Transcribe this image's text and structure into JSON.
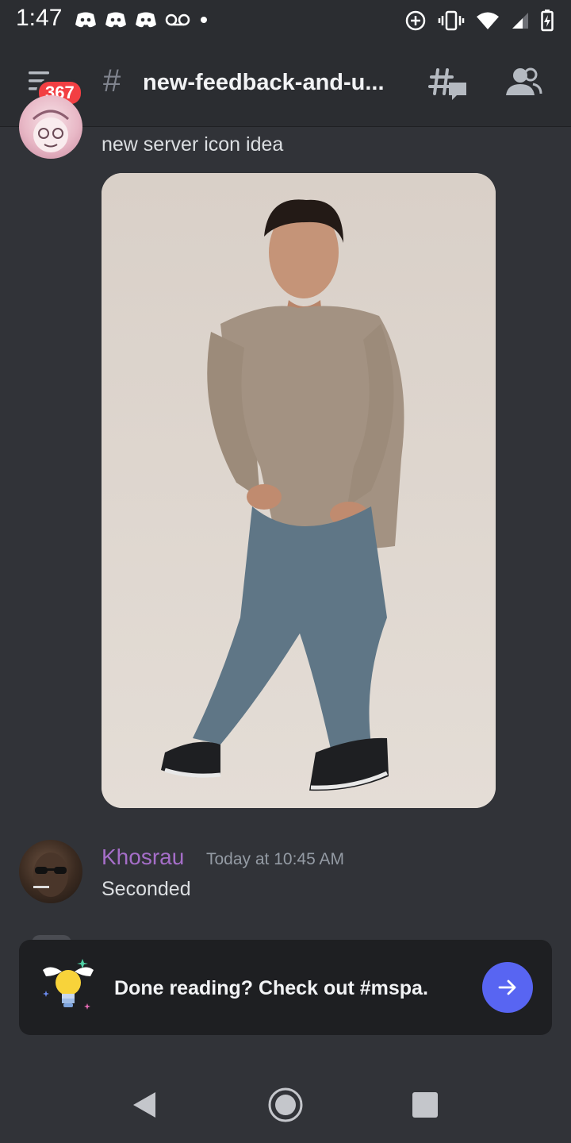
{
  "status_bar": {
    "time": "1:47",
    "left_icons": [
      "discord-icon",
      "discord-icon",
      "discord-icon",
      "voicemail-icon",
      "dot-icon"
    ],
    "right_icons": [
      "data-saver-icon",
      "vibrate-icon",
      "wifi-icon",
      "signal-icon",
      "battery-charging-icon"
    ]
  },
  "header": {
    "unread_count": "367",
    "hash": "#",
    "channel_name": "new-feedback-and-u...",
    "threads_icon": "threads-icon",
    "members_icon": "members-icon"
  },
  "messages": [
    {
      "text": "new server icon idea",
      "attachment": "photo"
    },
    {
      "author": "Khosrau",
      "author_color": "#a56ec8",
      "timestamp": "Today at 10:45 AM",
      "text": "Seconded"
    }
  ],
  "banner": {
    "text": "Done reading? Check out #mspa.",
    "button_icon": "arrow-right-icon",
    "accent": "#5865f2"
  },
  "colors": {
    "background": "#313338",
    "header": "#2b2d31",
    "badge": "#f23f43"
  }
}
